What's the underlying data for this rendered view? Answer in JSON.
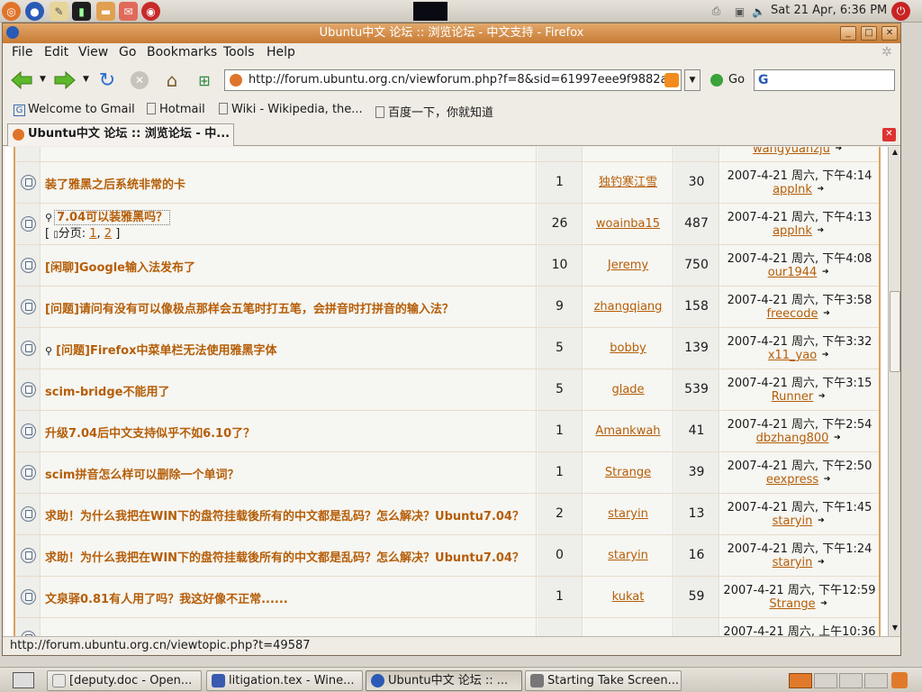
{
  "panel": {
    "clock": "Sat 21 Apr,  6:36 PM"
  },
  "window": {
    "title": "Ubuntu中文 论坛 :: 浏览论坛 - 中文支持 - Firefox",
    "min": "_",
    "max": "□",
    "close": "✕"
  },
  "menu": [
    "File",
    "Edit",
    "View",
    "Go",
    "Bookmarks",
    "Tools",
    "Help"
  ],
  "nav": {
    "url": "http://forum.ubuntu.org.cn/viewforum.php?f=8&sid=61997eee9f9882a",
    "go": "Go"
  },
  "bookmarks": [
    "Welcome to Gmail",
    "Hotmail",
    "Wiki - Wikipedia, the...",
    "百度一下，你就知道"
  ],
  "tab": {
    "label": "Ubuntu中文 论坛 :: 浏览论坛 - 中..."
  },
  "partial_top_user": "wangyuanzju",
  "topics": [
    {
      "title": "装了雅黑之后系统非常的卡",
      "replies": "1",
      "author": "独钓寒江雪",
      "views": "30",
      "date": "2007-4-21 周六, 下午4:14",
      "last": "applnk"
    },
    {
      "title": "7.04可以装雅黑吗？",
      "pages_prefix": "[ ",
      "pages_label": "分页: ",
      "p1": "1",
      "sep": ", ",
      "p2": "2",
      "pages_suffix": " ]",
      "replies": "26",
      "author": "woainba15",
      "views": "487",
      "date": "2007-4-21 周六, 下午4:13",
      "last": "applnk"
    },
    {
      "title": "[闲聊]Google输入法发布了",
      "replies": "10",
      "author": "Jeremy",
      "views": "750",
      "date": "2007-4-21 周六, 下午4:08",
      "last": "our1944"
    },
    {
      "title": "[问题]请问有没有可以像极点那样会五笔时打五笔，会拼音时打拼音的输入法？",
      "replies": "9",
      "author": "zhangqiang",
      "views": "158",
      "date": "2007-4-21 周六, 下午3:58",
      "last": "freecode"
    },
    {
      "title": "[问题]Firefox中菜单栏无法使用雅黑字体",
      "replies": "5",
      "author": "bobby",
      "views": "139",
      "date": "2007-4-21 周六, 下午3:32",
      "last": "x11_yao"
    },
    {
      "title": "scim-bridge不能用了",
      "replies": "5",
      "author": "glade",
      "views": "539",
      "date": "2007-4-21 周六, 下午3:15",
      "last": "Runner"
    },
    {
      "title": "升级7.04后中文支持似乎不如6.10了？",
      "replies": "1",
      "author": "Amankwah",
      "views": "41",
      "date": "2007-4-21 周六, 下午2:54",
      "last": "dbzhang800"
    },
    {
      "title": "scim拼音怎么样可以删除一个单词？",
      "replies": "1",
      "author": "Strange",
      "views": "39",
      "date": "2007-4-21 周六, 下午2:50",
      "last": "eexpress"
    },
    {
      "title": "求助！为什么我把在WIN下的盘符挂载後所有的中文都是乱码？怎么解决？Ubuntu7.04？",
      "replies": "2",
      "author": "staryin",
      "views": "13",
      "date": "2007-4-21 周六, 下午1:45",
      "last": "staryin"
    },
    {
      "title": "求助！为什么我把在WIN下的盘符挂载後所有的中文都是乱码？怎么解决？Ubuntu7.04？",
      "replies": "0",
      "author": "staryin",
      "views": "16",
      "date": "2007-4-21 周六, 下午1:24",
      "last": "staryin"
    },
    {
      "title": "文泉驿0.81有人用了吗？我这好像不正常......",
      "replies": "1",
      "author": "kukat",
      "views": "59",
      "date": "2007-4-21 周六, 下午12:59",
      "last": "Strange"
    },
    {
      "title": "",
      "replies": "",
      "author": "",
      "views": "",
      "date": "2007-4-21 周六, 上午10:36",
      "last": ""
    }
  ],
  "status": {
    "text": "http://forum.ubuntu.org.cn/viewtopic.php?t=49587"
  },
  "taskbar": [
    "[deputy.doc - Open...",
    "litigation.tex - Wine...",
    "Ubuntu中文 论坛 :: ...",
    "Starting Take Screen..."
  ],
  "colors": {
    "link": "#b55e08",
    "title_bar": "#d08a48",
    "border": "#d9a25e"
  },
  "icons": {
    "back": "arrow-left",
    "forward": "arrow-right",
    "reload": "reload",
    "stop": "stop",
    "home": "home",
    "topic": "topic-bubble",
    "goto_last": "arrow-right-small"
  }
}
